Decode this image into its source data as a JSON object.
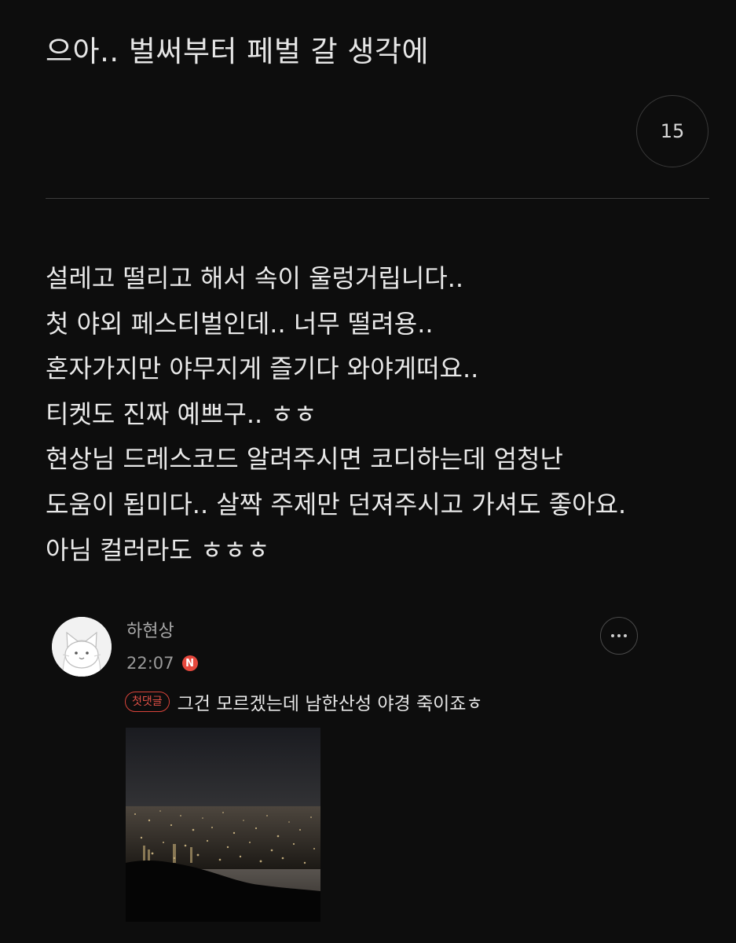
{
  "post": {
    "title": "으아.. 벌써부터 페벌 갈 생각에",
    "comment_count": "15",
    "body_lines": [
      "설레고 떨리고 해서 속이 울렁거립니다..",
      "첫 야외 페스티벌인데.. 너무 떨려용..",
      "혼자가지만 야무지게 즐기다 와야게떠요..",
      "티켓도 진짜 예쁘구.. ㅎㅎ",
      "현상님 드레스코드 알려주시면 코디하는데 엄청난",
      "도움이 됩미다.. 살짝 주제만 던져주시고 가셔도 좋아요.",
      "아님 컬러라도 ㅎㅎㅎ"
    ]
  },
  "comment": {
    "author": "하현상",
    "time": "22:07",
    "new_badge": "N",
    "first_comment_label": "첫댓글",
    "text": "그건 모르겠는데 남한산성 야경 죽이죠ㅎ",
    "avatar_icon": "cat-avatar-icon",
    "more_icon": "more-options-icon",
    "image_subject": "night-city-view-image"
  },
  "colors": {
    "background": "#0d0d0d",
    "accent_red": "#e5483d",
    "divider": "#3c3c3c"
  }
}
